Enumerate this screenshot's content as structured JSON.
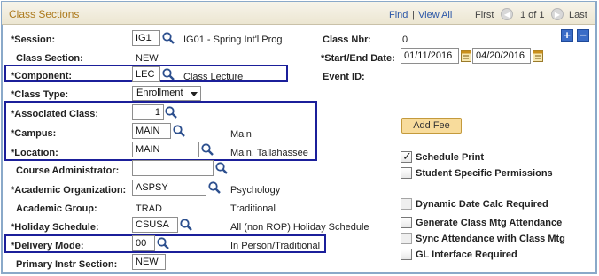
{
  "header": {
    "title": "Class Sections",
    "find": "Find",
    "separator": "|",
    "view_all": "View All",
    "first": "First",
    "page_info": "1 of 1",
    "last": "Last",
    "add_symbol": "+",
    "remove_symbol": "−"
  },
  "left": {
    "session": {
      "label": "*Session:",
      "value": "IG1",
      "desc": "IG01 - Spring Int'l Prog"
    },
    "class_section": {
      "label": "Class Section:",
      "value": "NEW"
    },
    "component": {
      "label": "*Component:",
      "value": "LEC",
      "desc": "Class Lecture"
    },
    "class_type": {
      "label": "*Class Type:",
      "value": "Enrollment"
    },
    "associated_class": {
      "label": "*Associated Class:",
      "value": "1"
    },
    "campus": {
      "label": "*Campus:",
      "value": "MAIN",
      "desc": "Main"
    },
    "location": {
      "label": "*Location:",
      "value": "MAIN",
      "desc": "Main, Tallahassee"
    },
    "course_admin": {
      "label": "Course Administrator:",
      "value": ""
    },
    "academic_org": {
      "label": "*Academic Organization:",
      "value": "ASPSY",
      "desc": "Psychology"
    },
    "academic_group": {
      "label": "Academic Group:",
      "value": "TRAD",
      "desc": "Traditional"
    },
    "holiday_schedule": {
      "label": "*Holiday Schedule:",
      "value": "CSUSA",
      "desc": "All (non ROP) Holiday Schedule"
    },
    "delivery_mode": {
      "label": "*Delivery Mode:",
      "value": "00",
      "desc": "In Person/Traditional"
    },
    "primary_instr": {
      "label": "Primary Instr Section:",
      "value": "NEW"
    }
  },
  "right": {
    "class_nbr": {
      "label": "Class Nbr:",
      "value": "0"
    },
    "dates": {
      "label": "*Start/End Date:",
      "start": "01/11/2016",
      "end": "04/20/2016"
    },
    "event_id": {
      "label": "Event ID:"
    },
    "add_fee": "Add Fee",
    "checkboxes": [
      {
        "label": "Schedule Print",
        "checked": true,
        "enabled": true
      },
      {
        "label": "Student Specific Permissions",
        "checked": false,
        "enabled": true
      },
      {
        "label": "Dynamic Date Calc Required",
        "checked": false,
        "enabled": false
      },
      {
        "label": "Generate Class Mtg Attendance",
        "checked": false,
        "enabled": true
      },
      {
        "label": "Sync Attendance with Class Mtg",
        "checked": false,
        "enabled": false
      },
      {
        "label": "GL Interface Required",
        "checked": false,
        "enabled": true
      }
    ]
  },
  "colors": {
    "title": "#ad7a1e",
    "link": "#2a56a7",
    "highlight": "#1b1f9a",
    "button": "#f8dc9c"
  },
  "icons": {
    "lookup": "magnifier-icon",
    "calendar": "calendar-icon",
    "prev": "previous-arrow-icon",
    "next": "next-arrow-icon"
  }
}
